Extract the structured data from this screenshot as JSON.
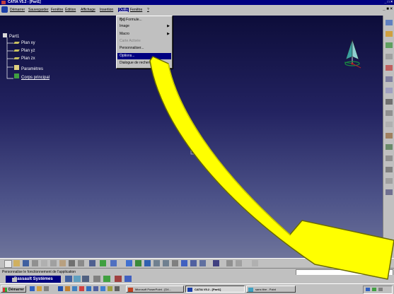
{
  "window": {
    "title": "CATIA V5.2 - [Part1]",
    "controls": "_ □ ×"
  },
  "menubar": {
    "items": [
      "Démarrer",
      "Sauvegarder",
      "Fenêtre",
      "Édition",
      "Affichage",
      "Insertion",
      "Outils",
      "Fenêtre",
      "?"
    ],
    "mdi_controls": "_ ■ ×"
  },
  "tree": {
    "root": "Part1",
    "items": [
      "Plan xy",
      "Plan yz",
      "Plan zx",
      "Paramètres",
      "Corps principal"
    ]
  },
  "dropdown": {
    "items": [
      {
        "label": "Formule...",
        "state": "normal",
        "prefix": "f(x)"
      },
      {
        "label": "Image",
        "state": "normal",
        "submenu": true
      },
      {
        "label": "Macro",
        "state": "normal",
        "submenu": true
      },
      {
        "label": "Carte Activée",
        "state": "disabled"
      },
      {
        "label": "Personnaliser...",
        "state": "normal"
      },
      {
        "label": "Options...",
        "state": "selected"
      },
      {
        "label": "Dialogue de recherche",
        "state": "normal"
      }
    ],
    "submenu_arrow": "▶"
  },
  "statusbar": {
    "message": "Personnalise le fonctionnement de l'application"
  },
  "ds_bar": {
    "brand": "Dassault Systèmes"
  },
  "taskbar": {
    "start_label": "Démarrer",
    "tasks": [
      {
        "label": "Microsoft PowerPoint - [D4...",
        "active": false
      },
      {
        "label": "CATIA V5.2 - [Part1]",
        "active": true
      },
      {
        "label": "sans titre - Paint",
        "active": false
      }
    ]
  },
  "colors": {
    "accent": "#000080",
    "arrow_fill": "#ffff00",
    "arrow_stroke": "#7a7a00"
  }
}
